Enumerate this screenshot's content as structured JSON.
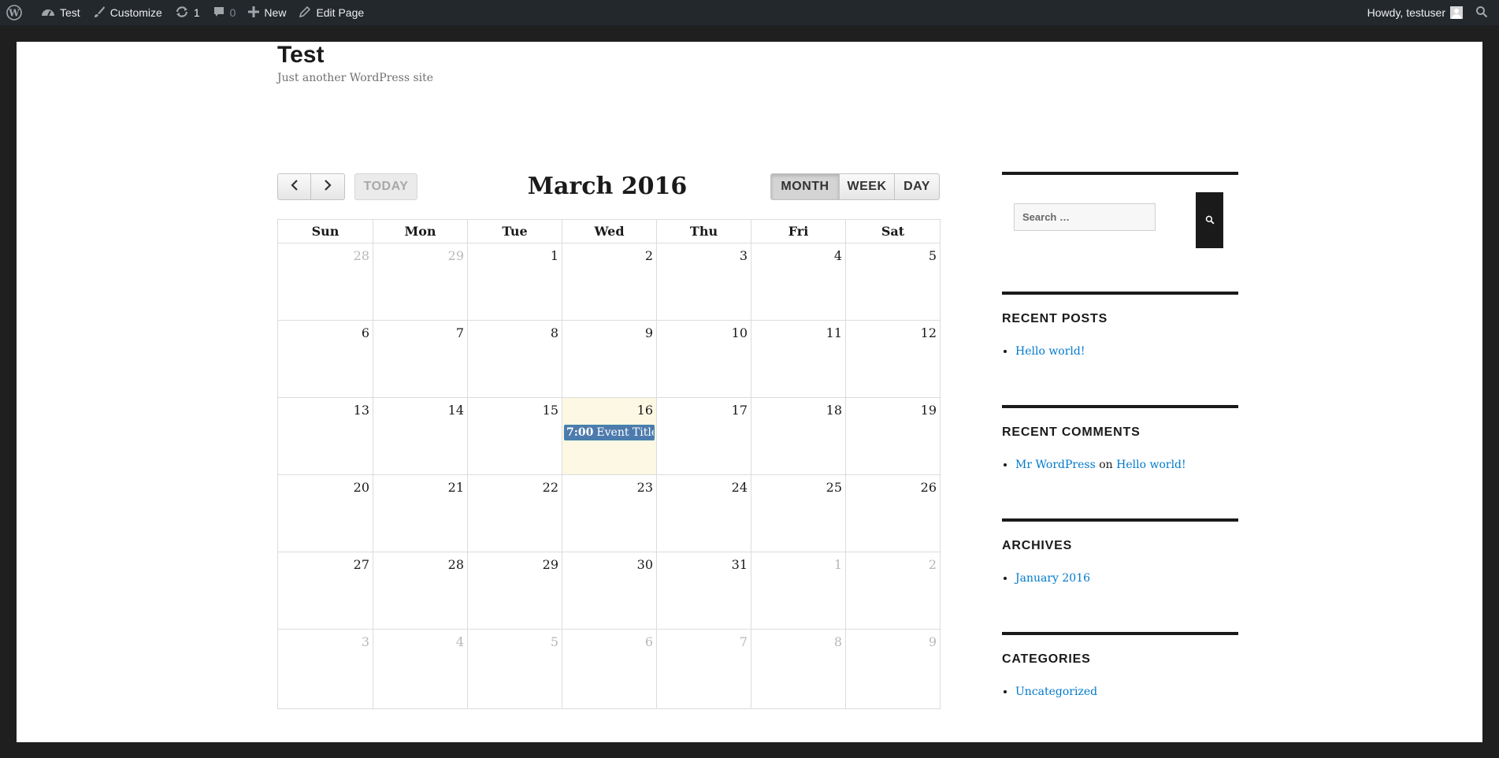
{
  "adminbar": {
    "site_name": "Test",
    "customize": "Customize",
    "updates_count": "1",
    "comments_count": "0",
    "new_label": "New",
    "edit_page": "Edit Page",
    "howdy": "Howdy, testuser",
    "icons": [
      "wordpress-logo-icon",
      "dashboard-icon",
      "brush-icon",
      "refresh-icon",
      "comment-icon",
      "plus-icon",
      "pencil-icon",
      "avatar",
      "search-icon"
    ]
  },
  "site": {
    "title": "Test",
    "description": "Just another WordPress site"
  },
  "calendar": {
    "title": "March 2016",
    "today_label": "TODAY",
    "view_month": "MONTH",
    "view_week": "WEEK",
    "view_day": "DAY",
    "active_view": "month",
    "weekdays": [
      "Sun",
      "Mon",
      "Tue",
      "Wed",
      "Thu",
      "Fri",
      "Sat"
    ],
    "weeks": [
      [
        {
          "n": "28",
          "other": true
        },
        {
          "n": "29",
          "other": true
        },
        {
          "n": "1"
        },
        {
          "n": "2"
        },
        {
          "n": "3"
        },
        {
          "n": "4"
        },
        {
          "n": "5"
        }
      ],
      [
        {
          "n": "6"
        },
        {
          "n": "7"
        },
        {
          "n": "8"
        },
        {
          "n": "9"
        },
        {
          "n": "10"
        },
        {
          "n": "11"
        },
        {
          "n": "12"
        }
      ],
      [
        {
          "n": "13"
        },
        {
          "n": "14"
        },
        {
          "n": "15"
        },
        {
          "n": "16",
          "today": true,
          "event": {
            "time": "7:00",
            "title": "Event Title"
          }
        },
        {
          "n": "17"
        },
        {
          "n": "18"
        },
        {
          "n": "19"
        }
      ],
      [
        {
          "n": "20"
        },
        {
          "n": "21"
        },
        {
          "n": "22"
        },
        {
          "n": "23"
        },
        {
          "n": "24"
        },
        {
          "n": "25"
        },
        {
          "n": "26"
        }
      ],
      [
        {
          "n": "27"
        },
        {
          "n": "28"
        },
        {
          "n": "29"
        },
        {
          "n": "30"
        },
        {
          "n": "31"
        },
        {
          "n": "1",
          "other": true
        },
        {
          "n": "2",
          "other": true
        }
      ],
      [
        {
          "n": "3",
          "other": true
        },
        {
          "n": "4",
          "other": true
        },
        {
          "n": "5",
          "other": true
        },
        {
          "n": "6",
          "other": true
        },
        {
          "n": "7",
          "other": true
        },
        {
          "n": "8",
          "other": true
        },
        {
          "n": "9",
          "other": true
        }
      ]
    ],
    "colors": {
      "today_bg": "#fcf8e3",
      "event_bg": "#4e7bad"
    }
  },
  "sidebar": {
    "search_placeholder": "Search …",
    "recent_posts": {
      "title": "RECENT POSTS",
      "items": [
        "Hello world!"
      ]
    },
    "recent_comments": {
      "title": "RECENT COMMENTS",
      "author": "Mr WordPress",
      "on": "on",
      "post": "Hello world!"
    },
    "archives": {
      "title": "ARCHIVES",
      "items": [
        "January 2016"
      ]
    },
    "categories": {
      "title": "CATEGORIES",
      "items": [
        "Uncategorized"
      ]
    },
    "link_color": "#007acc"
  }
}
